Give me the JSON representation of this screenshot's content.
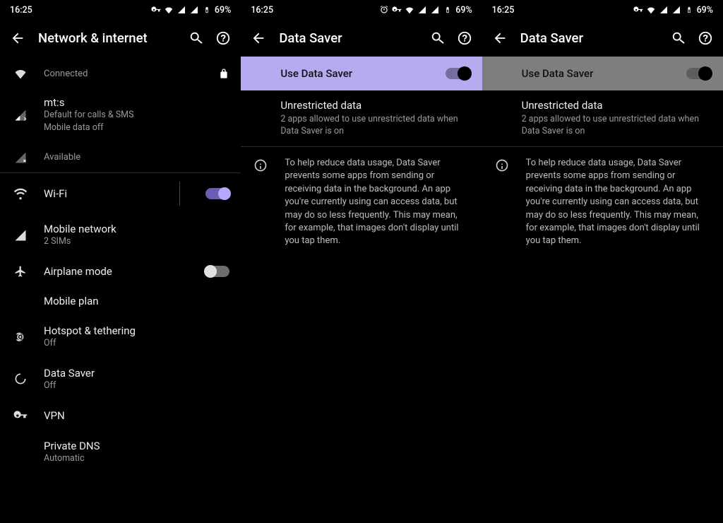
{
  "status": {
    "time": "16:25",
    "battery": "69%"
  },
  "panel1": {
    "title": "Network & internet",
    "items": [
      {
        "title": "Connected",
        "sub": "",
        "locked": true
      },
      {
        "title": "mt:s",
        "sub1": "Default for calls & SMS",
        "sub2": "Mobile data off"
      },
      {
        "title": "Available",
        "sub": ""
      },
      {
        "title": "Wi-Fi",
        "toggle": "on"
      },
      {
        "title": "Mobile network",
        "sub": "2 SIMs"
      },
      {
        "title": "Airplane mode",
        "toggle": "off"
      },
      {
        "title": "Mobile plan"
      },
      {
        "title": "Hotspot & tethering",
        "sub": "Off"
      },
      {
        "title": "Data Saver",
        "sub": "Off"
      },
      {
        "title": "VPN"
      },
      {
        "title": "Private DNS",
        "sub": "Automatic"
      }
    ]
  },
  "panel2": {
    "title": "Data Saver",
    "toggle_label": "Use Data Saver",
    "unrestricted_title": "Unrestricted data",
    "unrestricted_sub": "2 apps allowed to use unrestricted data when Data Saver is on",
    "info": "To help reduce data usage, Data Saver prevents some apps from sending or receiving data in the background. An app you're currently using can access data, but may do so less frequently. This may mean, for example, that images don't display until you tap them."
  },
  "panel3": {
    "title": "Data Saver",
    "toggle_label": "Use Data Saver",
    "unrestricted_title": "Unrestricted data",
    "unrestricted_sub": "2 apps allowed to use unrestricted data when Data Saver is on",
    "info": "To help reduce data usage, Data Saver prevents some apps from sending or receiving data in the background. An app you're currently using can access data, but may do so less frequently. This may mean, for example, that images don't display until you tap them."
  }
}
